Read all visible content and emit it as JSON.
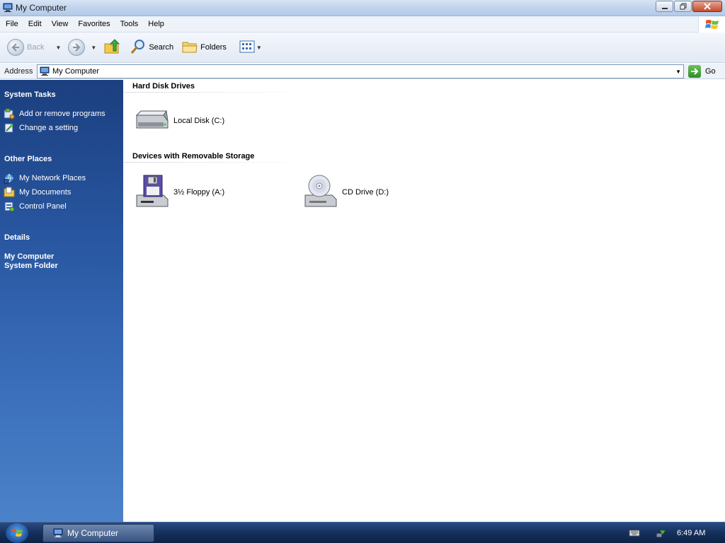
{
  "window": {
    "title": "My Computer"
  },
  "menubar": {
    "items": [
      "File",
      "Edit",
      "View",
      "Favorites",
      "Tools",
      "Help"
    ]
  },
  "toolbar": {
    "back_label": "Back",
    "search_label": "Search",
    "folders_label": "Folders"
  },
  "address": {
    "label": "Address",
    "value": "My Computer",
    "go_label": "Go"
  },
  "sidebar": {
    "system_tasks": {
      "title": "System Tasks",
      "items": [
        {
          "label": "Add or remove programs",
          "icon": "add-remove-programs-icon"
        },
        {
          "label": "Change a setting",
          "icon": "settings-icon"
        }
      ]
    },
    "other_places": {
      "title": "Other Places",
      "items": [
        {
          "label": "My Network Places",
          "icon": "network-places-icon"
        },
        {
          "label": "My Documents",
          "icon": "documents-folder-icon"
        },
        {
          "label": "Control Panel",
          "icon": "control-panel-icon"
        }
      ]
    },
    "details": {
      "title": "Details",
      "name": "My Computer",
      "type": "System Folder"
    }
  },
  "content": {
    "groups": [
      {
        "title": "Hard Disk Drives",
        "items": [
          {
            "label": "Local Disk (C:)",
            "icon": "hard-disk-icon"
          }
        ]
      },
      {
        "title": "Devices with Removable Storage",
        "items": [
          {
            "label": "3½ Floppy (A:)",
            "icon": "floppy-drive-icon"
          },
          {
            "label": "CD Drive (D:)",
            "icon": "cd-drive-icon"
          }
        ]
      }
    ]
  },
  "taskbar": {
    "active_window": "My Computer",
    "clock": "6:49 AM"
  },
  "colors": {
    "sidebar_top": "#1b3f7f",
    "sidebar_bottom": "#4b82c8",
    "taskbar": "#15305c",
    "go_green": "#2f8d27",
    "close_red": "#c74a2b"
  }
}
